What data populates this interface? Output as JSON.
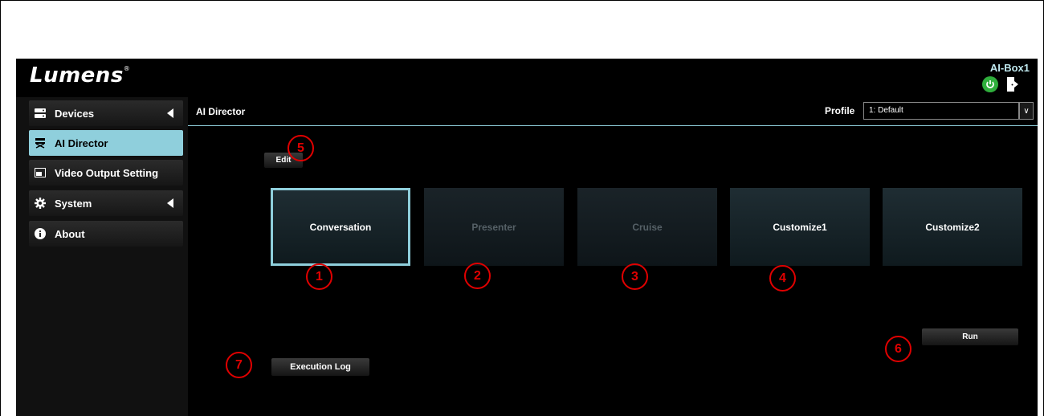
{
  "header": {
    "logo_text": "Lumens",
    "logo_mark": "®",
    "device_name": "AI-Box1",
    "power_icon": "power-icon",
    "logout_icon": "logout-icon",
    "power_color": "#2fae3c"
  },
  "sidebar": {
    "items": [
      {
        "label": "Devices",
        "icon": "devices-icon",
        "expandable": true
      },
      {
        "label": "AI Director",
        "icon": "director-chair-icon",
        "active": true
      },
      {
        "label": "Video Output Setting",
        "icon": "video-output-icon"
      },
      {
        "label": "System",
        "icon": "gear-icon",
        "expandable": true
      },
      {
        "label": "About",
        "icon": "info-icon"
      }
    ]
  },
  "main": {
    "title": "AI Director",
    "profile_label": "Profile",
    "profile_value": "1: Default",
    "edit_label": "Edit",
    "run_label": "Run",
    "execution_log_label": "Execution Log",
    "modes": [
      {
        "label": "Conversation",
        "selected": true
      },
      {
        "label": "Presenter",
        "disabled": true
      },
      {
        "label": "Cruise",
        "disabled": true
      },
      {
        "label": "Customize1"
      },
      {
        "label": "Customize2"
      }
    ],
    "accent_color": "#8fcfdc"
  },
  "annotations": [
    "1",
    "2",
    "3",
    "4",
    "5",
    "6",
    "7"
  ],
  "annotation_color": "#e00000"
}
